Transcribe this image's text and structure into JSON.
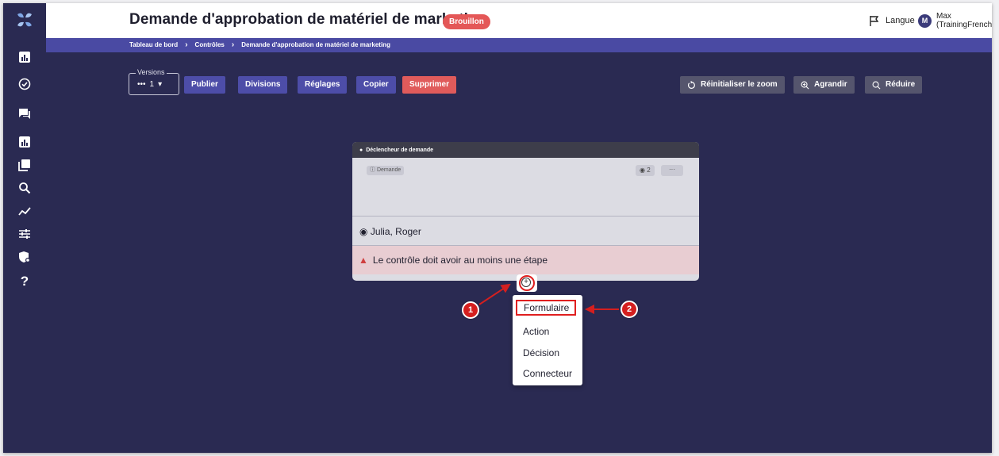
{
  "header": {
    "title": "Demande d'approbation de matériel de marketing",
    "status": "Brouillon",
    "language_label": "Langue",
    "user_initial": "M",
    "user_name_line1": "Max",
    "user_name_line2": "(TrainingFrench)"
  },
  "breadcrumb": [
    "Tableau de bord",
    "Contrôles",
    "Demande d'approbation de matériel de marketing"
  ],
  "toolbar": {
    "versions_label": "Versions",
    "versions_value": "1",
    "publish": "Publier",
    "divisions": "Divisions",
    "settings": "Réglages",
    "copy": "Copier",
    "delete": "Supprimer",
    "reset_zoom": "Réinitialiser le zoom",
    "zoom_in": "Agrandir",
    "zoom_out": "Réduire"
  },
  "card": {
    "header": "Déclencheur de demande",
    "request_chip": "Demande",
    "count": "2",
    "more": "···",
    "assignees": "Julia, Roger",
    "warning": "Le contrôle doit avoir au moins une étape"
  },
  "menu": {
    "items": [
      "Formulaire",
      "Action",
      "Décision",
      "Connecteur"
    ]
  },
  "callouts": [
    "1",
    "2"
  ],
  "colors": {
    "canvas": "#2a2a52",
    "accent": "#4d4da8",
    "danger": "#e05b5b",
    "callout": "#d41f1f"
  }
}
